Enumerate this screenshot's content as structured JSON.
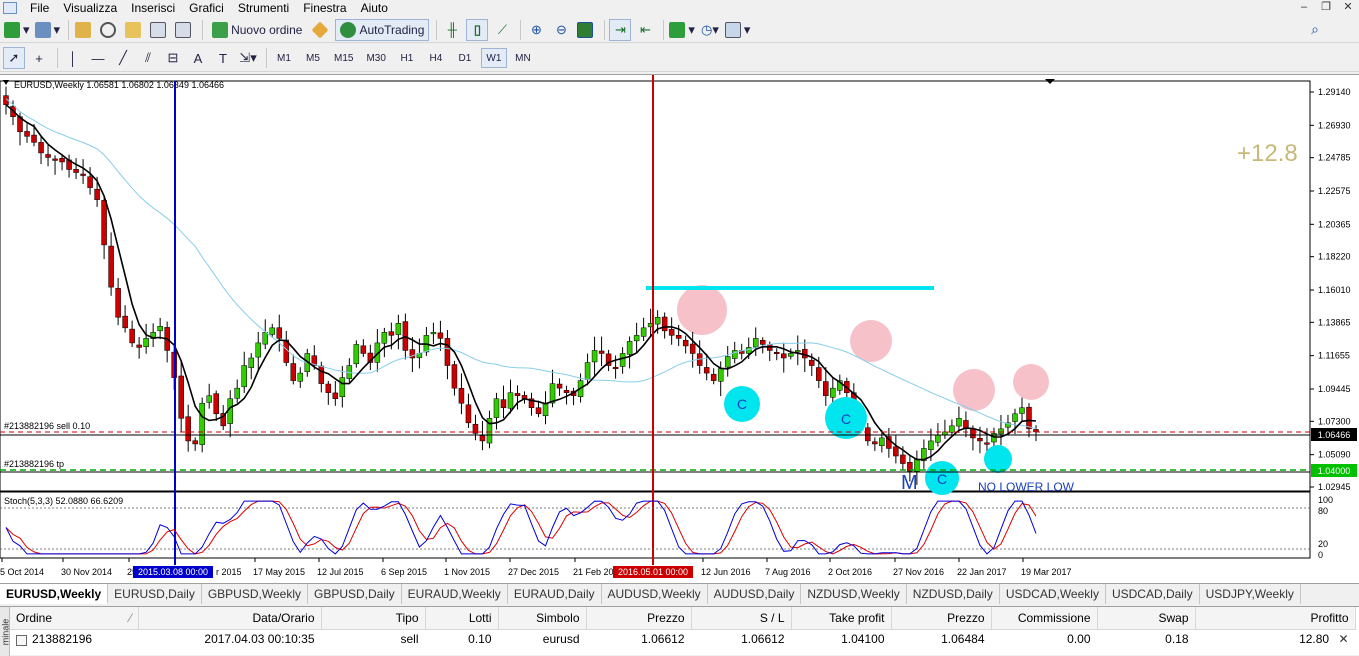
{
  "menu": {
    "items": [
      "File",
      "Visualizza",
      "Inserisci",
      "Grafici",
      "Strumenti",
      "Finestra",
      "Aiuto"
    ]
  },
  "toolbar": {
    "new_order_label": "Nuovo ordine",
    "autotrading_label": "AutoTrading",
    "timeframes": [
      "M1",
      "M5",
      "M15",
      "M30",
      "H1",
      "H4",
      "D1",
      "W1",
      "MN"
    ],
    "active_timeframe": "W1"
  },
  "chart": {
    "header": "EURUSD,Weekly  1.06581 1.06802 1.06349 1.06466",
    "sell_label": "#213882196 sell 0.10",
    "tp_label": "#213882196 tp",
    "big_value": "+12.8",
    "annotation_m": "M",
    "annotation_no_lower_low": "NO LOWER LOW",
    "circle_label": "C",
    "stoch_header": "Stoch(5,3,3) 52.0880 66.6209",
    "price_current": "1.06466",
    "price_tp": "1.04000",
    "price_ticks": [
      "1.29140",
      "1.26930",
      "1.24785",
      "1.22575",
      "1.20365",
      "1.18220",
      "1.16010",
      "1.13865",
      "1.11655",
      "1.09445",
      "1.07300",
      "1.05090",
      "1.02945"
    ],
    "stoch_ticks": [
      "100",
      "80",
      "20",
      "0"
    ],
    "date_ticks": [
      "5 Oct 2014",
      "30 Nov 2014",
      "25",
      "17 May 2015",
      "12 Jul 2015",
      "6 Sep 2015",
      "1 Nov 2015",
      "27 Dec 2015",
      "21 Feb 20",
      "12 Jun 2016",
      "7 Aug 2016",
      "2 Oct 2016",
      "27 Nov 2016",
      "22 Jan 2017",
      "19 Mar 2017"
    ],
    "vline_blue_label": "2015.03.08 00:00",
    "vline_red_label": "2016.05.01 00:00",
    "vline_blue_tail": "r 2015"
  },
  "chart_data": {
    "type": "candlestick",
    "symbol": "EURUSD",
    "timeframe": "Weekly",
    "open": 1.06581,
    "high": 1.06802,
    "low": 1.06349,
    "close": 1.06466,
    "ylim": [
      1.02945,
      1.2914
    ],
    "close_path": [
      1.283,
      1.275,
      1.265,
      1.262,
      1.258,
      1.251,
      1.248,
      1.246,
      1.245,
      1.24,
      1.238,
      1.236,
      1.228,
      1.22,
      1.19,
      1.162,
      1.142,
      1.135,
      1.125,
      1.122,
      1.128,
      1.132,
      1.136,
      1.12,
      1.102,
      1.075,
      1.06,
      1.058,
      1.085,
      1.09,
      1.078,
      1.07,
      1.088,
      1.095,
      1.11,
      1.115,
      1.125,
      1.132,
      1.135,
      1.128,
      1.112,
      1.1,
      1.105,
      1.118,
      1.11,
      1.098,
      1.092,
      1.088,
      1.102,
      1.11,
      1.124,
      1.118,
      1.112,
      1.125,
      1.132,
      1.13,
      1.138,
      1.12,
      1.115,
      1.118,
      1.13,
      1.132,
      1.128,
      1.11,
      1.095,
      1.085,
      1.072,
      1.065,
      1.06,
      1.075,
      1.088,
      1.082,
      1.092,
      1.09,
      1.088,
      1.082,
      1.078,
      1.085,
      1.098,
      1.095,
      1.092,
      1.09,
      1.1,
      1.112,
      1.12,
      1.118,
      1.11,
      1.108,
      1.118,
      1.126,
      1.13,
      1.135,
      1.138,
      1.142,
      1.133,
      1.13,
      1.128,
      1.123,
      1.118,
      1.11,
      1.105,
      1.1,
      1.108,
      1.116,
      1.12,
      1.118,
      1.122,
      1.128,
      1.124,
      1.12,
      1.118,
      1.115,
      1.118,
      1.12,
      1.115,
      1.11,
      1.1,
      1.09,
      1.095,
      1.1,
      1.092,
      1.08,
      1.07,
      1.06,
      1.058,
      1.062,
      1.055,
      1.05,
      1.045,
      1.04,
      1.048,
      1.055,
      1.06,
      1.064,
      1.066,
      1.07,
      1.075,
      1.068,
      1.062,
      1.06,
      1.058,
      1.065,
      1.068,
      1.072,
      1.078,
      1.082,
      1.068,
      1.066
    ],
    "stoch": {
      "k": 52.088,
      "d": 66.6209
    }
  },
  "tabs": [
    "EURUSD,Weekly",
    "EURUSD,Daily",
    "GBPUSD,Weekly",
    "GBPUSD,Daily",
    "EURAUD,Weekly",
    "EURAUD,Daily",
    "AUDUSD,Weekly",
    "AUDUSD,Daily",
    "NZDUSD,Weekly",
    "NZDUSD,Daily",
    "USDCAD,Weekly",
    "USDCAD,Daily",
    "USDJPY,Weekly"
  ],
  "terminal": {
    "side_label": "minale",
    "columns": [
      "Ordine",
      "Data/Orario",
      "Tipo",
      "Lotti",
      "Simbolo",
      "Prezzo",
      "S / L",
      "Take profit",
      "Prezzo",
      "Commissione",
      "Swap",
      "Profitto"
    ],
    "row": [
      "213882196",
      "2017.04.03 00:10:35",
      "sell",
      "0.10",
      "eurusd",
      "1.06612",
      "1.06612",
      "1.04100",
      "1.06484",
      "0.00",
      "0.18",
      "12.80"
    ]
  },
  "colors": {
    "bull": "#33cc00",
    "bear": "#cc0000",
    "ma_fast": "#000000",
    "ma_slow": "#87ceeb",
    "cyan": "#00e5ee",
    "pink": "#f4b6c0",
    "vline_blue": "#0000cc",
    "vline_red": "#cc0000"
  }
}
